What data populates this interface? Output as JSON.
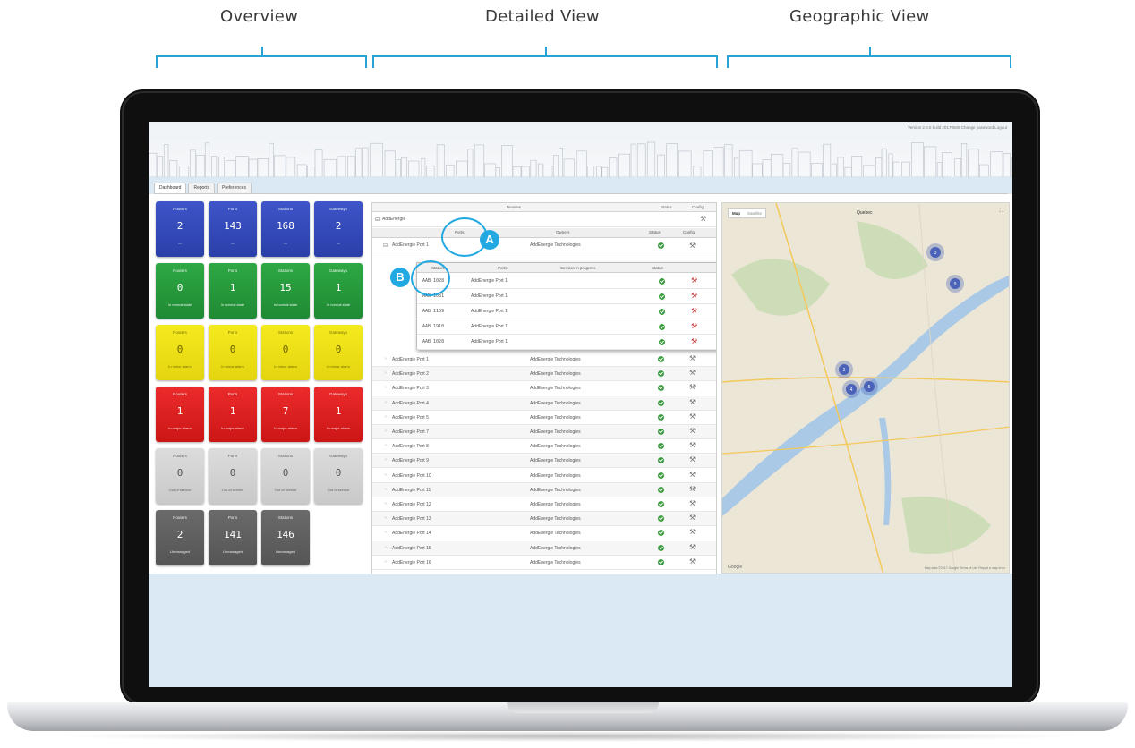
{
  "sections": {
    "overview": "Overview",
    "detailed": "Detailed View",
    "geographic": "Geographic View"
  },
  "app": {
    "status_text": "Version 2.8.0 build 20170509   Change password   Logout",
    "tabs": [
      "Dashboard",
      "Reports",
      "Preferences"
    ]
  },
  "overview": {
    "columns": [
      "Routers",
      "Ports",
      "Stations",
      "Gateways"
    ],
    "rows": [
      {
        "color": "blue",
        "values": [
          "2",
          "143",
          "168",
          "2"
        ],
        "footer": "—"
      },
      {
        "color": "green",
        "values": [
          "0",
          "1",
          "15",
          "1"
        ],
        "footer": "In normal state"
      },
      {
        "color": "yellow",
        "values": [
          "0",
          "0",
          "0",
          "0"
        ],
        "footer": "In minor alarm"
      },
      {
        "color": "red",
        "values": [
          "1",
          "1",
          "7",
          "1"
        ],
        "footer": "In major alarm"
      },
      {
        "color": "lgray",
        "values": [
          "0",
          "0",
          "0",
          "0"
        ],
        "footer": "Out of service"
      },
      {
        "color": "dgray",
        "values": [
          "2",
          "141",
          "146"
        ],
        "footer": "Unmanaged"
      }
    ]
  },
  "detailed": {
    "group_headers": {
      "devices": "Devices",
      "status": "Status",
      "config": "Config"
    },
    "root_label": "AddEnergie",
    "columns": {
      "ports": "Ports",
      "owners": "Owners",
      "status": "Status",
      "config": "Config"
    },
    "popup": {
      "columns": {
        "stations": "Stations",
        "ports": "Ports",
        "session": "Session in progress",
        "status": "Status"
      },
      "rows": [
        {
          "id": "AAB 1028",
          "port": "AddEnergie Port 1"
        },
        {
          "id": "AAB 1081",
          "port": "AddEnergie Port 1"
        },
        {
          "id": "AAB 1109",
          "port": "AddEnergie Port 1"
        },
        {
          "id": "AAB 1910",
          "port": "AddEnergie Port 1"
        },
        {
          "id": "AAB 1028",
          "port": "AddEnergie Port 1"
        }
      ]
    },
    "first_row": {
      "name": "AddEnergie Port 1",
      "owner": "AddEnergie Technologies"
    },
    "rows": [
      {
        "name": "AddEnergie Port 1",
        "owner": "AddEnergie Technologies"
      },
      {
        "name": "AddEnergie Port 2",
        "owner": "AddEnergie Technologies"
      },
      {
        "name": "AddEnergie Port 3",
        "owner": "AddEnergie Technologies"
      },
      {
        "name": "AddEnergie Port 4",
        "owner": "AddEnergie Technologies"
      },
      {
        "name": "AddEnergie Port 5",
        "owner": "AddEnergie Technologies"
      },
      {
        "name": "AddEnergie Port 7",
        "owner": "AddEnergie Technologies"
      },
      {
        "name": "AddEnergie Port 8",
        "owner": "AddEnergie Technologies"
      },
      {
        "name": "AddEnergie Port 9",
        "owner": "AddEnergie Technologies"
      },
      {
        "name": "AddEnergie Port 10",
        "owner": "AddEnergie Technologies"
      },
      {
        "name": "AddEnergie Port 11",
        "owner": "AddEnergie Technologies"
      },
      {
        "name": "AddEnergie Port 12",
        "owner": "AddEnergie Technologies"
      },
      {
        "name": "AddEnergie Port 13",
        "owner": "AddEnergie Technologies"
      },
      {
        "name": "AddEnergie Port 14",
        "owner": "AddEnergie Technologies"
      },
      {
        "name": "AddEnergie Port 15",
        "owner": "AddEnergie Technologies"
      },
      {
        "name": "AddEnergie Port 16",
        "owner": "AddEnergie Technologies"
      }
    ],
    "callouts": [
      "A",
      "B"
    ],
    "status_icon": "check-circle-icon",
    "config_icon": "wrench-icon"
  },
  "map": {
    "toggle": [
      "Map",
      "Satellite"
    ],
    "title": "Quebec",
    "attribution": "Google",
    "terms": "Map data ©2017 Google   Terms of Use   Report a map error",
    "cluster_counts": [
      "3",
      "9",
      "2",
      "4",
      "5"
    ],
    "colors": {
      "land": "#ece6d6",
      "water": "#a9c9e6",
      "park": "#c5dbb0",
      "road": "#f4c85a",
      "cluster": "#4a63b8"
    }
  }
}
